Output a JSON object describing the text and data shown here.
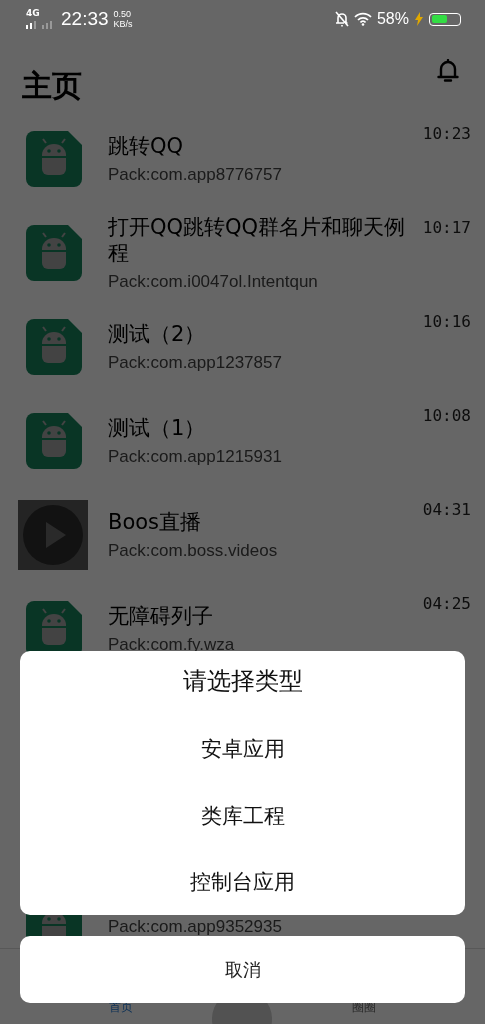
{
  "status_bar": {
    "network": "4G",
    "time": "22:33",
    "speed": "0.50",
    "speed_unit": "KB/s",
    "battery_text": "58%",
    "battery": {
      "level": 0.58
    }
  },
  "header": {
    "title": "主页"
  },
  "apps": [
    {
      "kind": "app",
      "title": "跳转QQ",
      "pack": "Pack:com.app8776757",
      "time": "10:23"
    },
    {
      "kind": "app",
      "title": "打开QQ跳转QQ群名片和聊天例程",
      "pack": "Pack:com.i0047ol.Intentqun",
      "time": "10:17"
    },
    {
      "kind": "app",
      "title": "测试（2）",
      "pack": "Pack:com.app1237857",
      "time": "10:16"
    },
    {
      "kind": "app",
      "title": "测试（1）",
      "pack": "Pack:com.app1215931",
      "time": "10:08"
    },
    {
      "kind": "video",
      "title": "Boos直播",
      "pack": "Pack:com.boss.videos",
      "time": "04:31"
    },
    {
      "kind": "app",
      "title": "无障碍列子",
      "pack": "Pack:com.fy.wza",
      "time": "04:25"
    },
    {
      "kind": "partial",
      "pack": "Pack:com.app9352935"
    }
  ],
  "bottom_nav": [
    {
      "label": "首页",
      "selected": true
    },
    {
      "label": "圈圈",
      "selected": false
    }
  ],
  "dialog": {
    "title": "请选择类型",
    "options": [
      "安卓应用",
      "类库工程",
      "控制台应用"
    ],
    "cancel": "取消"
  }
}
